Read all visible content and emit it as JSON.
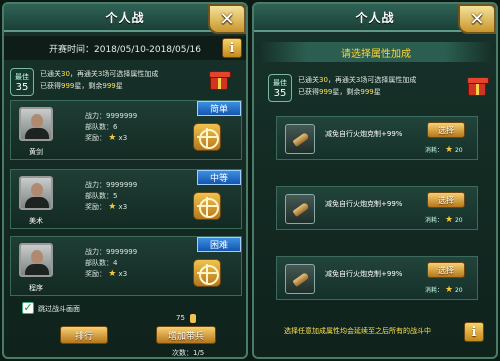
{
  "left": {
    "title": "个人战",
    "close_glyph": "✕",
    "date_label": "开赛时间：2018/05/10-2018/05/16",
    "info_icon": "i",
    "best_label": "最佳",
    "best_value": "35",
    "line1_a": "已通关",
    "line1_n": "30",
    "line1_b": "，再通关",
    "line1_m": "3",
    "line1_c": "场可选择属性加成",
    "line2_a": "已获得",
    "line2_n": "999",
    "line2_b": "星，剩余",
    "line2_m": "999",
    "line2_c": "星",
    "cards": [
      {
        "difficulty": "简单",
        "name": "黄剑",
        "power": "战力：9999999",
        "troops": "部队数：6",
        "reward": "奖励：",
        "reward_count": "x3"
      },
      {
        "difficulty": "中等",
        "name": "美术",
        "power": "战力：9999999",
        "troops": "部队数：5",
        "reward": "奖励：",
        "reward_count": "x3"
      },
      {
        "difficulty": "困难",
        "name": "程序",
        "power": "战力：9999999",
        "troops": "部队数：4",
        "reward": "奖励：",
        "reward_count": "x3"
      }
    ],
    "skip_check": "✓",
    "skip_label": "跳过战斗画面",
    "coin_count": "75",
    "rank_button": "排行",
    "add_troops_button": "增加带兵",
    "attempts": "次数：1/5"
  },
  "right": {
    "title": "个人战",
    "close_glyph": "✕",
    "subtitle": "请选择属性加成",
    "best_label": "最佳",
    "best_value": "35",
    "line1_a": "已通关",
    "line1_n": "30",
    "line1_b": "，再通关",
    "line1_m": "3",
    "line1_c": "场可选择属性加成",
    "line2_a": "已获得",
    "line2_n": "999",
    "line2_b": "星，剩余",
    "line2_m": "999",
    "line2_c": "星",
    "options": [
      {
        "text": "减免自行火炮克制+99%",
        "button": "选择",
        "cost_label": "消耗：",
        "cost": "20"
      },
      {
        "text": "减免自行火炮克制+99%",
        "button": "选择",
        "cost_label": "消耗：",
        "cost": "20"
      },
      {
        "text": "减免自行火炮克制+99%",
        "button": "选择",
        "cost_label": "消耗：",
        "cost": "20"
      }
    ],
    "footer": "选择任意加成属性均会延续至之后所有的战斗中",
    "info_icon": "i"
  }
}
